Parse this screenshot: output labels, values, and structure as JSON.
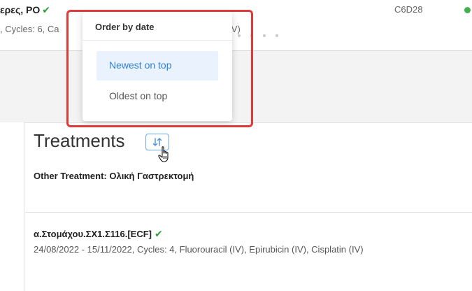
{
  "background_row": {
    "title": "ερες, PO",
    "subtitle_left": ", Cycles: 6, Ca",
    "subtitle_right": "e (IV)",
    "code": "C6D28",
    "status_dot_color": "#43b14a"
  },
  "treatments": {
    "title": "Treatments",
    "other_treatment": "Other Treatment: Ολική Γαστρεκτομή",
    "regimen": {
      "name": "α.Στομάχου.ΣΧ1.Σ116.[ECF]",
      "details": "24/08/2022 - 15/11/2022, Cycles: 4, Fluorouracil (IV), Epirubicin (IV), Cisplatin (IV)"
    }
  },
  "order_menu": {
    "header": "Order by date",
    "options": [
      {
        "label": "Newest on top",
        "selected": true
      },
      {
        "label": "Oldest on top",
        "selected": false
      }
    ]
  },
  "colors": {
    "accent": "#2f7fe0",
    "highlight_box": "#de3a3a",
    "check": "#2e9e3b"
  }
}
